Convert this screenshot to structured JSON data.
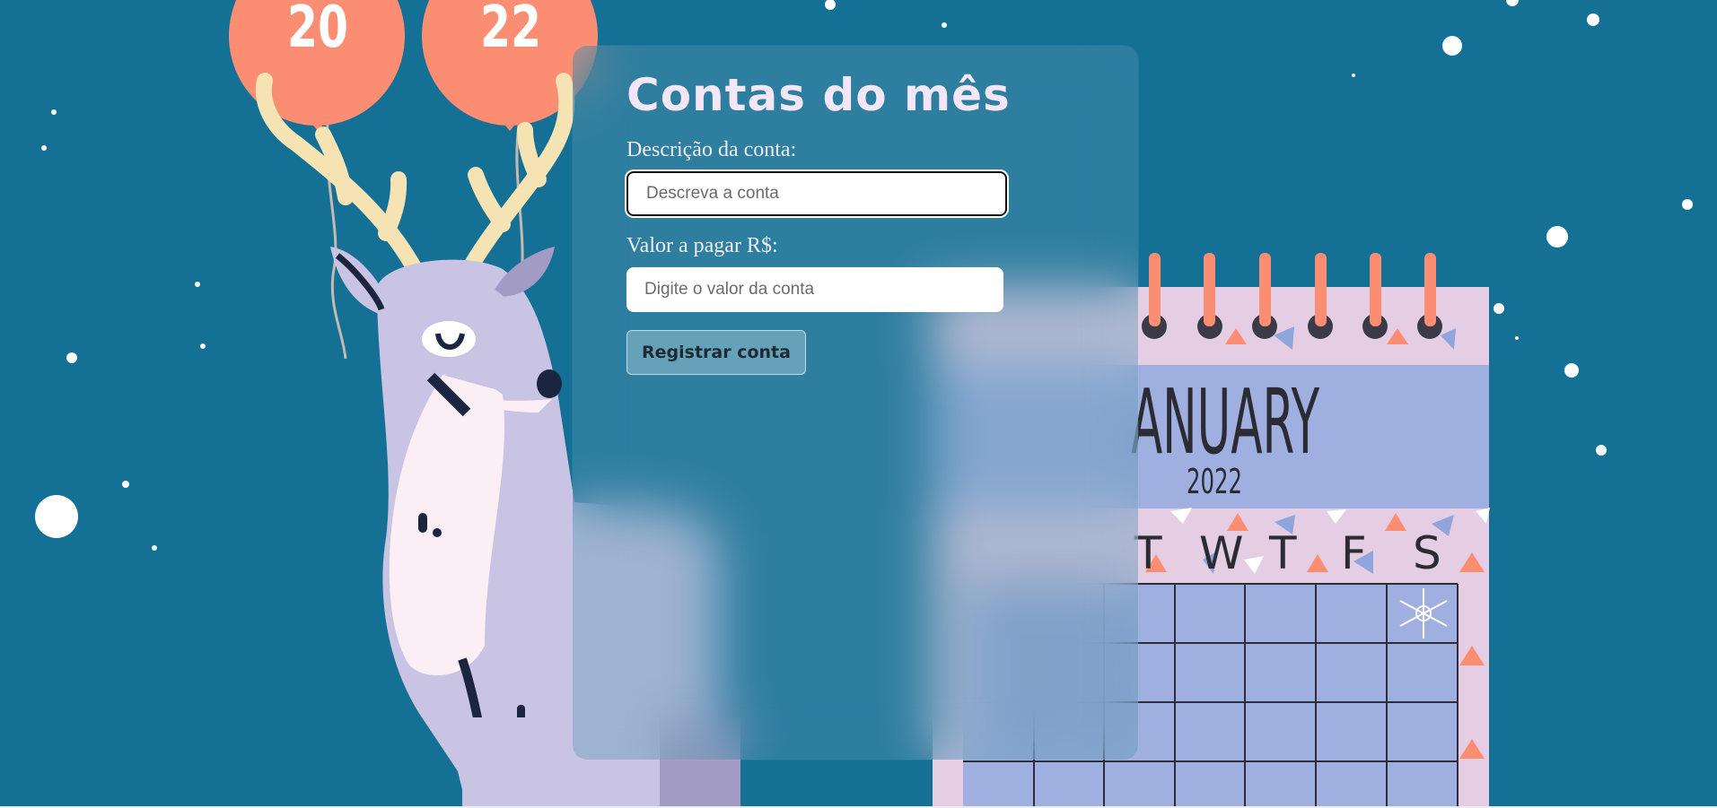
{
  "header": {
    "title": "Contas do mês"
  },
  "form": {
    "description_label": "Descrição da conta:",
    "description_placeholder": "Descreva a conta",
    "value_label": "Valor a pagar R$:",
    "value_placeholder": "Digite o valor da conta",
    "submit_label": "Registrar conta"
  },
  "background": {
    "balloon_left_text": "20",
    "balloon_right_text": "22",
    "calendar_month": "ANUARY",
    "calendar_year": "2022",
    "weekdays": [
      "T",
      "W",
      "T",
      "F",
      "S"
    ],
    "colors": {
      "sky": "#147095",
      "balloon": "#fa8d72",
      "calendar_pink": "#e5cde4",
      "calendar_blue": "#9fb0e0"
    }
  }
}
